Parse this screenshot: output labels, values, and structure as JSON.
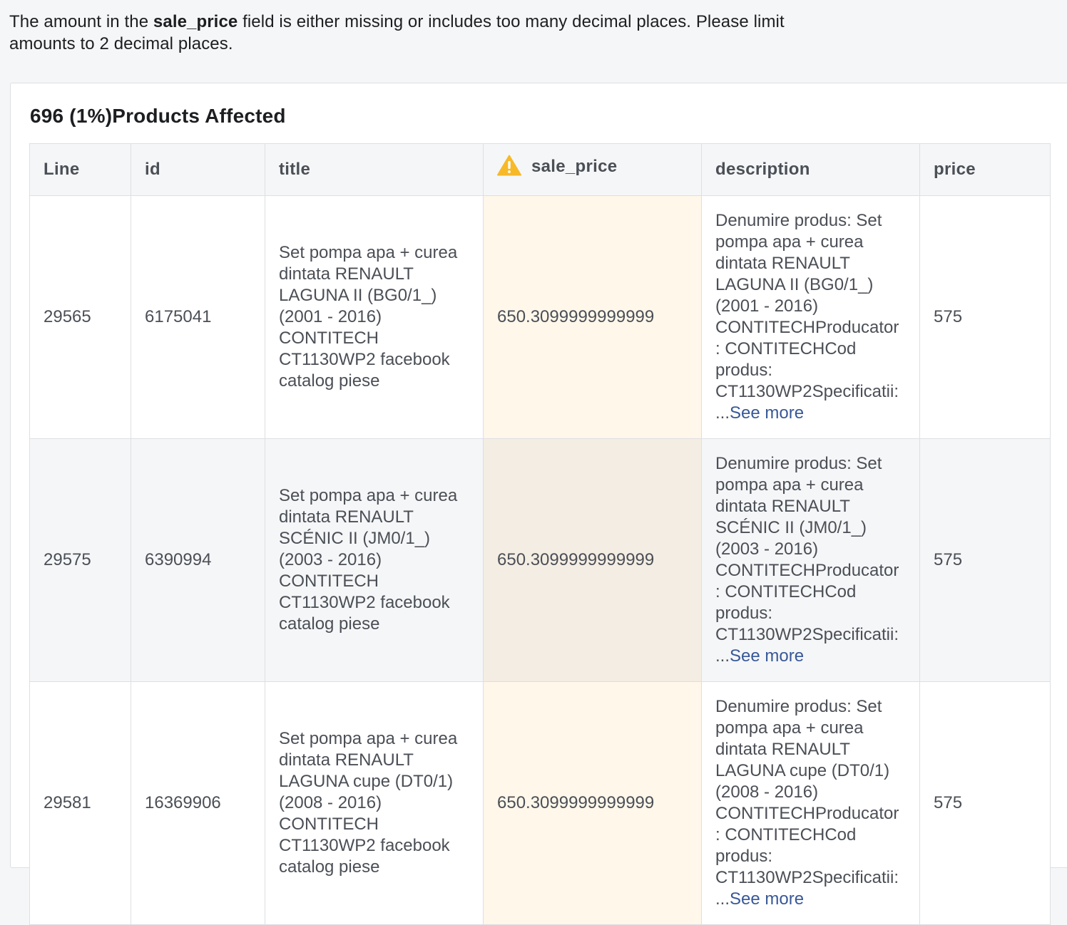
{
  "notice": {
    "prefix": "The amount in the ",
    "field": "sale_price",
    "suffix": " field is either missing or includes too many decimal places. Please limit amounts to 2 decimal places."
  },
  "card": {
    "title": "696 (1%)Products Affected"
  },
  "table": {
    "headers": {
      "line": "Line",
      "id": "id",
      "title": "title",
      "sale_price": "sale_price",
      "description": "description",
      "price": "price"
    },
    "warning_icon": "warning-triangle-icon",
    "warning_color": "#f7b928",
    "rows": [
      {
        "line": "29565",
        "id": "6175041",
        "title": "Set pompa apa + curea dintata RENAULT LAGUNA II (BG0/1_) (2001 - 2016) CONTITECH CT1130WP2 facebook catalog piese",
        "sale_price": "650.3099999999999",
        "description": "Denumire produs: Set pompa apa + curea dintata RENAULT LAGUNA II (BG0/1_) (2001 - 2016) CONTITECHProducator : CONTITECHCod produs: CT1130WP2Specificatii: ...",
        "see_more": "See more",
        "price": "575"
      },
      {
        "line": "29575",
        "id": "6390994",
        "title": "Set pompa apa + curea dintata RENAULT SCÉNIC II (JM0/1_) (2003 - 2016) CONTITECH CT1130WP2 facebook catalog piese",
        "sale_price": "650.3099999999999",
        "description": "Denumire produs: Set pompa apa + curea dintata RENAULT SCÉNIC II (JM0/1_) (2003 - 2016) CONTITECHProducator : CONTITECHCod produs: CT1130WP2Specificatii: ...",
        "see_more": "See more",
        "price": "575"
      },
      {
        "line": "29581",
        "id": "16369906",
        "title": "Set pompa apa + curea dintata RENAULT LAGUNA cupe (DT0/1) (2008 - 2016) CONTITECH CT1130WP2 facebook catalog piese",
        "sale_price": "650.3099999999999",
        "description": "Denumire produs: Set pompa apa + curea dintata RENAULT LAGUNA cupe (DT0/1) (2008 - 2016) CONTITECHProducator : CONTITECHCod produs: CT1130WP2Specificatii: ...",
        "see_more": "See more",
        "price": "575"
      }
    ]
  }
}
